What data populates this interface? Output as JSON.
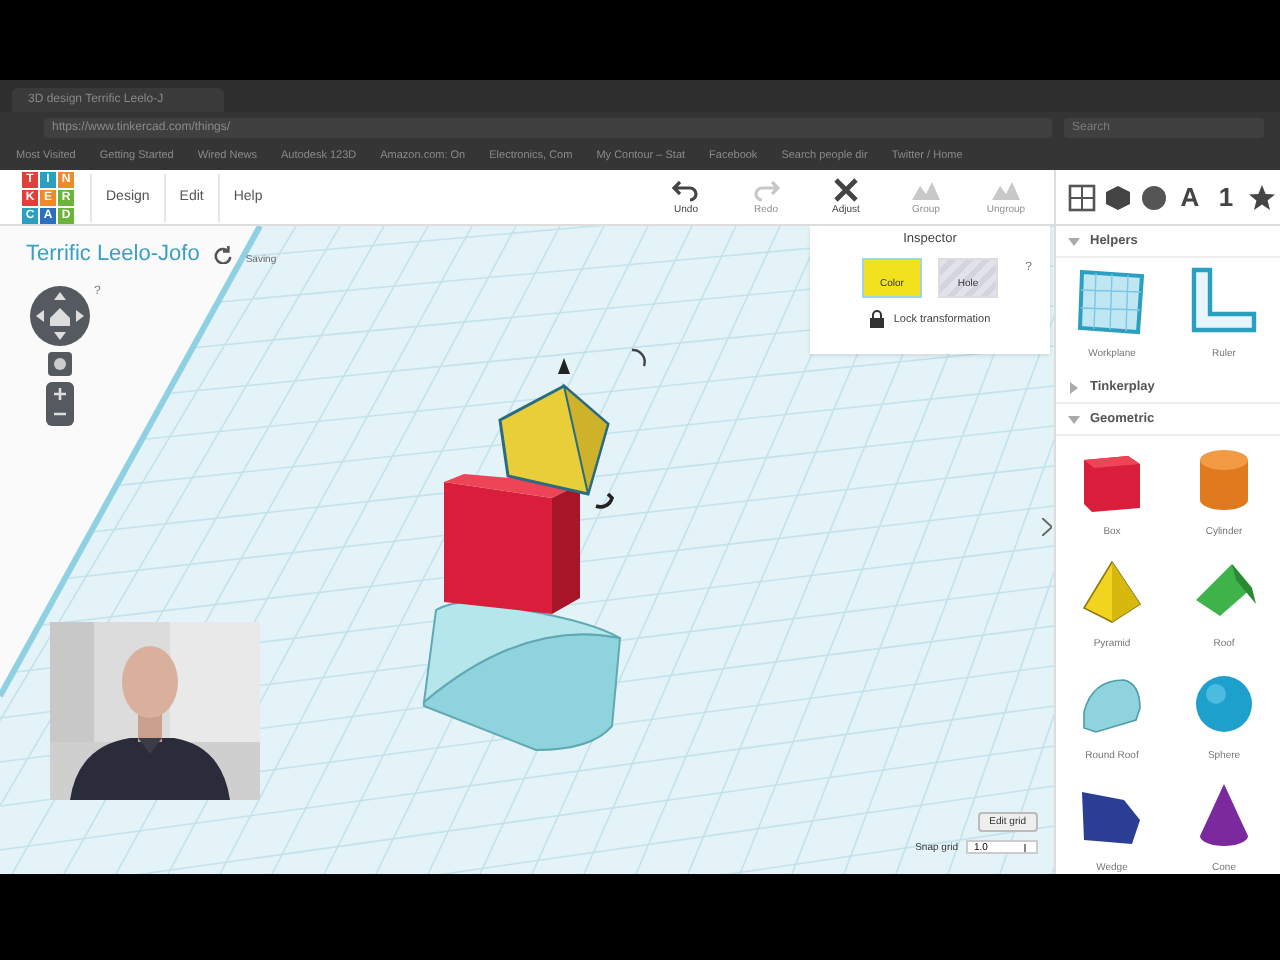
{
  "browser": {
    "tab_title": "3D design Terrific Leelo-J",
    "url": "https://www.tinkercad.com/things/",
    "search_placeholder": "Search",
    "bookmarks": [
      "Most Visited",
      "Getting Started",
      "Wired News",
      "Autodesk 123D",
      "Amazon.com: On",
      "Electronics, Com",
      "My Contour – Stat",
      "Facebook",
      "Search people dir",
      "Twitter / Home"
    ]
  },
  "logo": [
    {
      "letter": "T",
      "color": "#e0403a"
    },
    {
      "letter": "I",
      "color": "#2a9fc0"
    },
    {
      "letter": "N",
      "color": "#ef8a2a"
    },
    {
      "letter": "K",
      "color": "#e0403a"
    },
    {
      "letter": "E",
      "color": "#ef8a2a"
    },
    {
      "letter": "R",
      "color": "#6bb33c"
    },
    {
      "letter": "C",
      "color": "#2a9fc0"
    },
    {
      "letter": "A",
      "color": "#2a6fc0"
    },
    {
      "letter": "D",
      "color": "#6bb33c"
    }
  ],
  "menu": [
    "Design",
    "Edit",
    "Help"
  ],
  "tools": [
    {
      "label": "Undo",
      "kind": "undo",
      "disabled": false
    },
    {
      "label": "Redo",
      "kind": "redo",
      "disabled": true
    },
    {
      "label": "Adjust",
      "kind": "adjust",
      "disabled": false
    },
    {
      "label": "Group",
      "kind": "group",
      "disabled": true
    },
    {
      "label": "Ungroup",
      "kind": "ungroup",
      "disabled": true
    }
  ],
  "library_tabs": [
    {
      "kind": "workplane"
    },
    {
      "kind": "cube"
    },
    {
      "kind": "ball"
    },
    {
      "kind": "text",
      "label": "A"
    },
    {
      "kind": "text",
      "label": "1"
    },
    {
      "kind": "star"
    }
  ],
  "design_title": "Terrific Leelo-Jofo",
  "save_status": "Saving",
  "help_mark": "?",
  "inspector": {
    "title": "Inspector",
    "help_mark": "?",
    "swatches": [
      {
        "label": "Color",
        "kind": "solid",
        "selected": true
      },
      {
        "label": "Hole",
        "kind": "hole",
        "selected": false
      }
    ],
    "lock_label": "Lock transformation"
  },
  "grid": {
    "edit_button": "Edit grid",
    "snap_label": "Snap grid",
    "snap_value": "1.0"
  },
  "sections": [
    {
      "title": "Helpers",
      "expanded": true,
      "items": [
        {
          "label": "Workplane",
          "kind": "workplane"
        },
        {
          "label": "Ruler",
          "kind": "ruler"
        }
      ]
    },
    {
      "title": "Tinkerplay",
      "expanded": false
    },
    {
      "title": "Geometric",
      "expanded": true,
      "items": [
        {
          "label": "Box",
          "kind": "box"
        },
        {
          "label": "Cylinder",
          "kind": "cylinder"
        },
        {
          "label": "Pyramid",
          "kind": "pyramid"
        },
        {
          "label": "Roof",
          "kind": "roof"
        },
        {
          "label": "Round Roof",
          "kind": "round_roof"
        },
        {
          "label": "Sphere",
          "kind": "sphere"
        },
        {
          "label": "Wedge",
          "kind": "wedge"
        },
        {
          "label": "Cone",
          "kind": "cone"
        }
      ]
    }
  ]
}
